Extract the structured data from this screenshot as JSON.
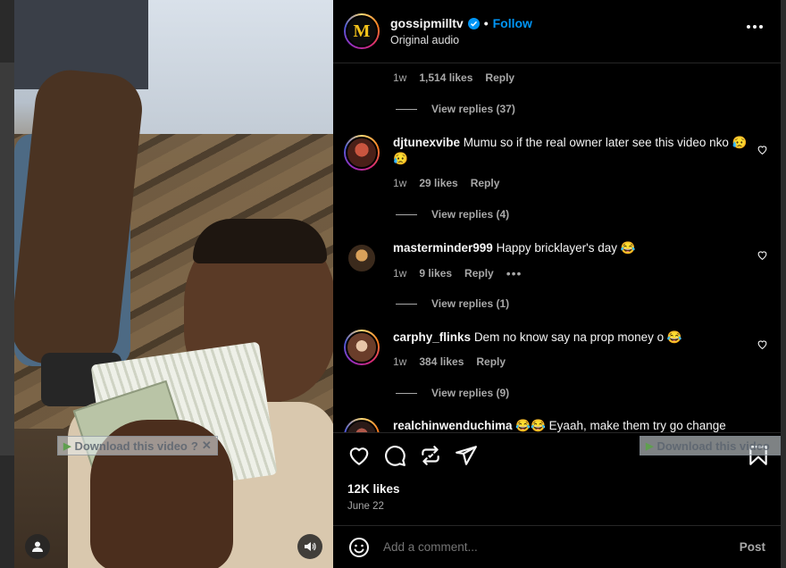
{
  "post": {
    "username": "gossipmilltv",
    "separator": "•",
    "follow_label": "Follow",
    "audio": "Original audio",
    "likes": "12K likes",
    "date": "June 22"
  },
  "thread_top": {
    "time": "1w",
    "likes": "1,514 likes",
    "reply_label": "Reply",
    "view_replies": "View replies (37)"
  },
  "comments": [
    {
      "username": "djtunexvibe",
      "text": "Mumu so if the real owner later see this video nko 😥😥",
      "time": "1w",
      "likes": "29 likes",
      "reply_label": "Reply",
      "view_replies": "View replies (4)"
    },
    {
      "username": "masterminder999",
      "text": "Happy bricklayer's day 😂",
      "time": "1w",
      "likes": "9 likes",
      "reply_label": "Reply",
      "more": "•••",
      "view_replies": "View replies (1)"
    },
    {
      "username": "carphy_flinks",
      "text": "Dem no know say na prop money o 😂",
      "time": "1w",
      "likes": "384 likes",
      "reply_label": "Reply",
      "view_replies": "View replies (9)"
    },
    {
      "username": "realchinwenduchima",
      "text": "😂😂 Eyaah, make them try go change"
    }
  ],
  "comment_box": {
    "placeholder": "Add a comment...",
    "post_label": "Post"
  },
  "overlay": {
    "download_label": "Download this video",
    "help": "?",
    "close": "✕"
  },
  "icons": {
    "verified": "verified-badge-icon",
    "like": "heart-icon",
    "comment": "comment-icon",
    "share": "repost-icon",
    "send": "send-icon",
    "save": "bookmark-icon",
    "emoji": "emoji-icon",
    "more": "more-options-icon",
    "profile": "user-icon",
    "audio": "speaker-icon"
  },
  "colors": {
    "accent": "#0095f6",
    "panel_bg": "#000000",
    "muted_text": "#a8a8a8"
  }
}
